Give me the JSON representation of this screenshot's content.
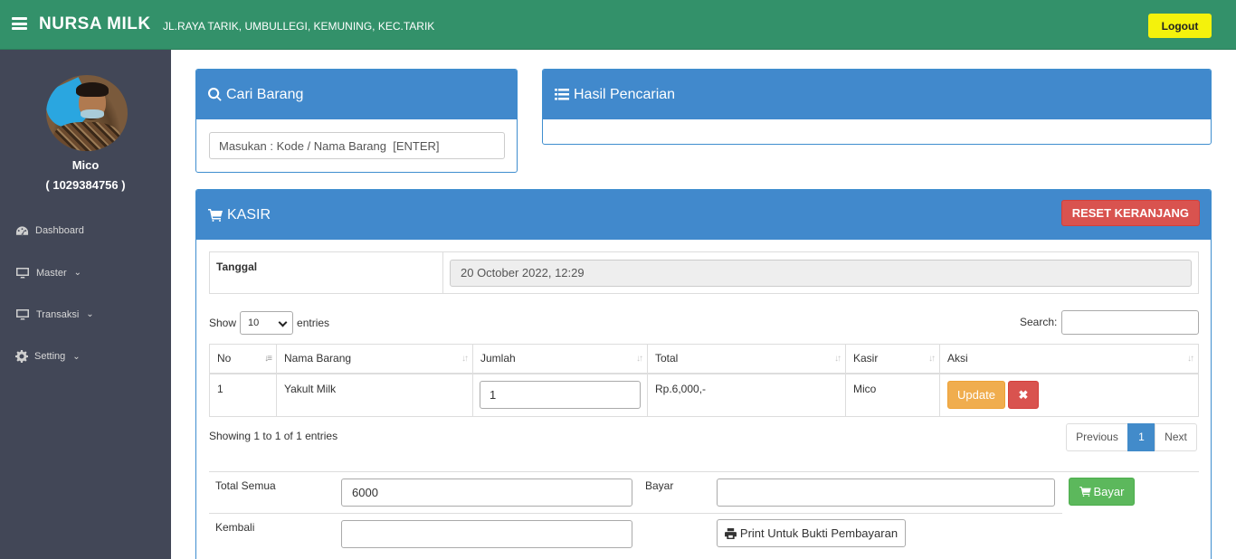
{
  "header": {
    "brand": "NURSA MILK",
    "address": "JL.RAYA TARIK, UMBULLEGI, KEMUNING, KEC.TARIK",
    "logout_label": "Logout",
    "colors": {
      "bar": "#33916a",
      "logout": "#f4f20c"
    }
  },
  "sidebar": {
    "user_name": "Mico",
    "user_id": "( 1029384756 )",
    "items": [
      {
        "label": "Dashboard",
        "icon": "dashboard-icon"
      },
      {
        "label": "Master",
        "icon": "desktop-icon",
        "dropdown": true
      },
      {
        "label": "Transaksi",
        "icon": "desktop-icon",
        "dropdown": true
      },
      {
        "label": "Setting",
        "icon": "gear-icon",
        "dropdown": true
      }
    ]
  },
  "search_panel": {
    "title": "Cari Barang",
    "placeholder": "Masukan : Kode / Nama Barang  [ENTER]"
  },
  "result_panel": {
    "title": "Hasil Pencarian"
  },
  "kasir": {
    "title": "KASIR",
    "reset_label": "RESET KERANJANG",
    "date_label": "Tanggal",
    "date_value": "20 October 2022, 12:29",
    "show_label": "Show",
    "show_value": "10",
    "entries_label": "entries",
    "search_label": "Search:",
    "columns": [
      "No",
      "Nama Barang",
      "Jumlah",
      "Total",
      "Kasir",
      "Aksi"
    ],
    "rows": [
      {
        "no": "1",
        "nama": "Yakult Milk",
        "jumlah": "1",
        "total": "Rp.6,000,-",
        "kasir": "Mico",
        "update_label": "Update",
        "delete_label": "✖"
      }
    ],
    "info": "Showing 1 to 1 of 1 entries",
    "pager": {
      "prev": "Previous",
      "current": "1",
      "next": "Next"
    },
    "total_label": "Total Semua",
    "total_value": "6000",
    "bayar_label": "Bayar",
    "bayar_value": "",
    "bayar_button": "Bayar",
    "kembali_label": "Kembali",
    "kembali_value": "",
    "print_label": "Print Untuk Bukti Pembayaran"
  }
}
